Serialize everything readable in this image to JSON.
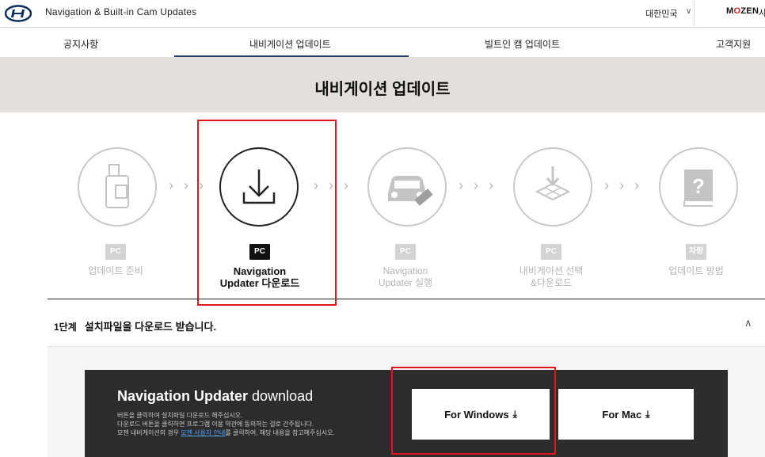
{
  "header": {
    "site_title": "Navigation & Built-in Cam Updates",
    "language": "대한민국",
    "language_chevron": "∨",
    "brand_pre": "M",
    "brand_o": "O",
    "brand_post": "ZEN",
    "brand_extra": "사"
  },
  "nav": {
    "items": [
      {
        "label": "공지사항"
      },
      {
        "label": "내비게이션 업데이트",
        "active": true
      },
      {
        "label": "빌트인 캠 업데이트"
      },
      {
        "label": "고객지원"
      }
    ]
  },
  "banner": {
    "title": "내비게이션 업데이트"
  },
  "steps": {
    "arrow": "› › ›",
    "items": [
      {
        "badge": "PC",
        "label_line1": "업데이트 준비",
        "label_line2": "",
        "icon": "usb-drive-icon"
      },
      {
        "badge": "PC",
        "label_line1": "Navigation",
        "label_line2": "Updater 다운로드",
        "icon": "download-icon",
        "active": true
      },
      {
        "badge": "PC",
        "label_line1": "Navigation",
        "label_line2": "Updater 실행",
        "icon": "car-usb-icon"
      },
      {
        "badge": "PC",
        "label_line1": "내비게이션 선택",
        "label_line2": "&다운로드",
        "icon": "map-download-icon"
      },
      {
        "badge": "차량",
        "label_line1": "업데이트 방법",
        "label_line2": "",
        "icon": "manual-book-icon"
      }
    ]
  },
  "section1": {
    "stage": "1단계",
    "title": "설치파일을 다운로드 받습니다.",
    "chevron": "∧"
  },
  "download": {
    "title_bold": "Navigation Updater",
    "title_light": " download",
    "desc_line1": "버튼을 클릭하여 설치파일 다운로드 해주십시오.",
    "desc_line2": "다운로드 버튼을 클릭하면 프로그램 이용 약관에 동의하는 걸로 간주됩니다.",
    "desc_line3_pre": "모젠 내비게이션의 경우 ",
    "desc_line3_link": "모젠 사용자 안내",
    "desc_line3_post": "를 클릭하여, 해당 내용을 참고해주십시오.",
    "windows_label": "For Windows",
    "mac_label": "For Mac",
    "download_glyph": "⤓"
  },
  "colors": {
    "highlight": "#e0181b",
    "nav_active": "#1f3b66",
    "banner_bg": "#e3dfda",
    "panel_bg": "#2c2c2c",
    "link": "#4aa3ff"
  }
}
